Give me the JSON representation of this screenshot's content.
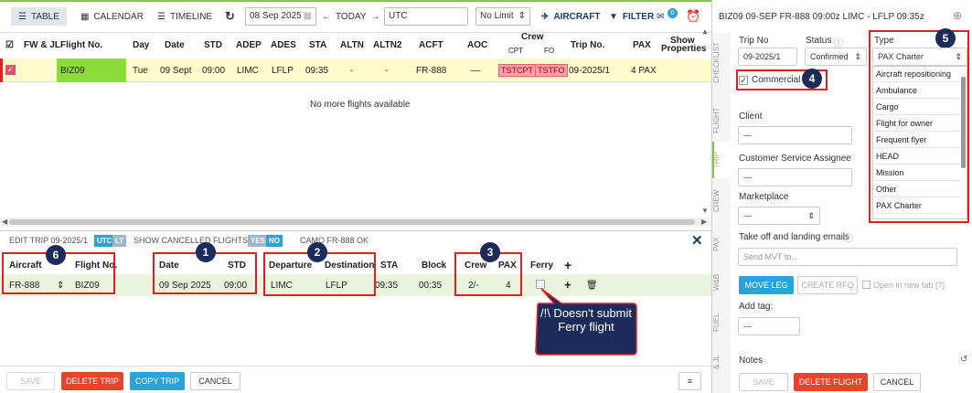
{
  "toolbar": {
    "table": "TABLE",
    "calendar": "CALENDAR",
    "timeline": "TIMELINE",
    "date": "08 Sep 2025",
    "today": "TODAY",
    "tz": "UTC",
    "limit": "No Limit",
    "aircraft": "AIRCRAFT",
    "filter": "FILTER",
    "msg_count": "0"
  },
  "grid": {
    "headers": [
      "FW & JL",
      "Flight No.",
      "Day",
      "Date",
      "STD",
      "ADEP",
      "ADES",
      "STA",
      "ALTN",
      "ALTN2",
      "ACFT",
      "AOC",
      "Crew",
      "CPT",
      "FO",
      "Trip No.",
      "PAX",
      "Show",
      "Properties"
    ],
    "row": {
      "flight": "BIZ09",
      "day": "Tue",
      "date": "09 Sept",
      "std": "09:00",
      "adep": "LIMC",
      "ades": "LFLP",
      "sta": "09:35",
      "altn": "-",
      "altn2": "-",
      "acft": "FR-888",
      "aoc": "—",
      "cpt": "TSTCPT",
      "fo": "TSTFO",
      "trip": "09-2025/1",
      "pax": "4 PAX"
    },
    "empty": "No more flights available"
  },
  "edit": {
    "title": "EDIT TRIP 09-2025/1",
    "utc": "UTC",
    "lt": "LT",
    "show_cancelled": "SHOW CANCELLED FLIGHTS",
    "yes": "YES",
    "no": "NO",
    "camo": "CAMO FR-888 OK",
    "headers": [
      "Aircraft",
      "Flight No.",
      "Date",
      "STD",
      "Departure",
      "Destination",
      "STA",
      "Block",
      "Crew",
      "PAX",
      "Ferry"
    ],
    "leg": {
      "aircraft": "FR-888",
      "flight": "BIZ09",
      "date": "09 Sep 2025",
      "std": "09:00",
      "dep": "LIMC",
      "dest": "LFLP",
      "sta": "09:35",
      "block": "00:35",
      "crew": "2/-",
      "pax": "4"
    },
    "note": "/!\\ Doesn't submit Ferry flight",
    "save": "SAVE",
    "delete": "DELETE TRIP",
    "copy": "COPY TRIP",
    "cancel": "CANCEL"
  },
  "badges": [
    "1",
    "2",
    "3",
    "4",
    "5",
    "6"
  ],
  "panel": {
    "title": "BIZ09 09-SEP FR-888 09:00z LIMC - LFLP 09:35z",
    "tabs": [
      "CHECKLIST",
      "FLIGHT",
      "TRIP",
      "CREW",
      "PAX",
      "W&B",
      "FUEL",
      "& JL"
    ],
    "trip_no_label": "Trip No",
    "trip_no": "09-2025/1",
    "status_label": "Status",
    "status": "Confirmed",
    "type_label": "Type",
    "type": "PAX Charter",
    "commercial": "Commercial",
    "client": "Client",
    "client_ph": "---",
    "csa": "Customer Service Assignee",
    "csa_ph": "---",
    "marketplace": "Marketplace",
    "mp_ph": "---",
    "emails": "Take off and landing emails",
    "emails_ph": "Send MVT to...",
    "move": "MOVE LEG",
    "rfq": "CREATE RFQ",
    "newtab": "Open in new tab [?]",
    "addtag": "Add tag:",
    "tag_ph": "---",
    "notes": "Notes",
    "save": "SAVE",
    "delete": "DELETE FLIGHT",
    "cancel": "CANCEL",
    "options": [
      "Aircraft repositioning",
      "Ambulance",
      "Cargo",
      "Flight for owner",
      "Frequent flyer",
      "HEAD",
      "Mission",
      "Other",
      "PAX Charter"
    ]
  },
  "colors": {
    "accent": "#1c2b59",
    "green": "#8bc34a",
    "red_btn": "#e8442c",
    "blue_btn": "#29a3d9"
  }
}
